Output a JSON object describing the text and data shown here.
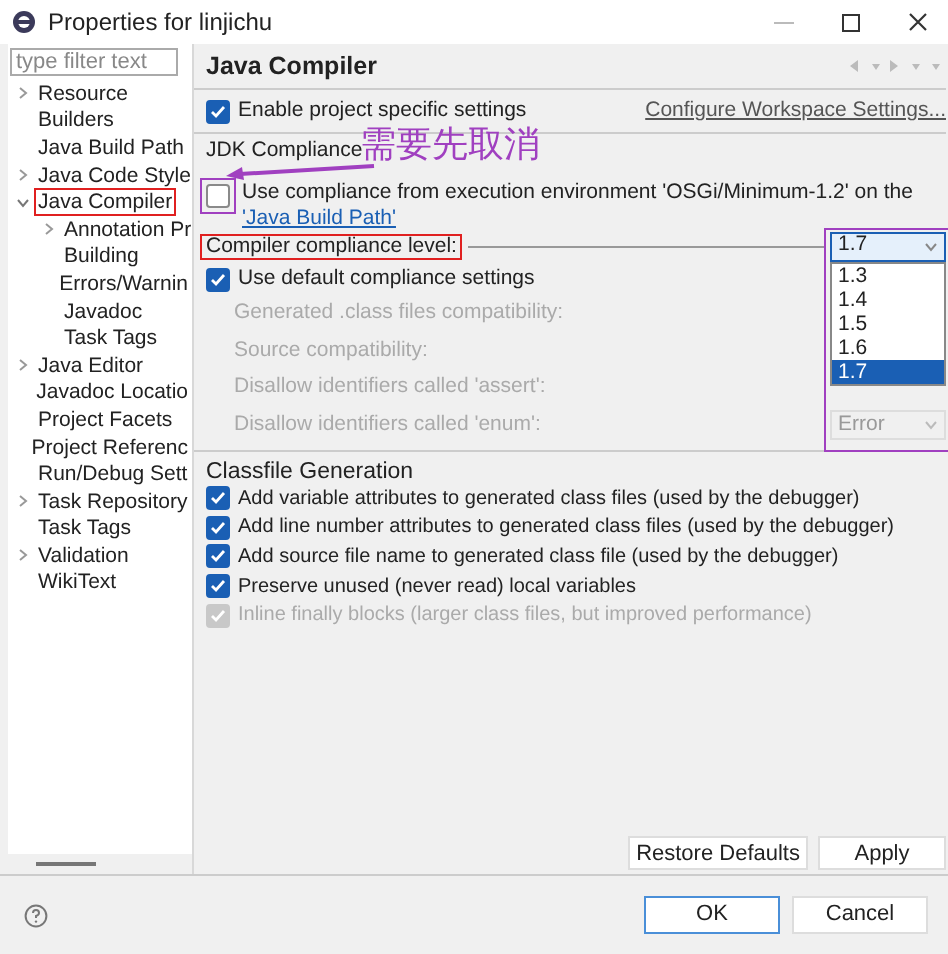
{
  "window": {
    "title": "Properties for linjichu"
  },
  "sidebar": {
    "filter": {
      "placeholder": "type filter text"
    },
    "items": [
      {
        "label": "Resource",
        "expanded": false
      },
      {
        "label": "Builders"
      },
      {
        "label": "Java Build Path"
      },
      {
        "label": "Java Code Style",
        "expanded": false
      },
      {
        "label": "Java Compiler",
        "expanded": true,
        "annotated": true,
        "children": [
          {
            "label": "Annotation Pr",
            "expanded": false
          },
          {
            "label": "Building"
          },
          {
            "label": "Errors/Warnin"
          },
          {
            "label": "Javadoc"
          },
          {
            "label": "Task Tags"
          }
        ]
      },
      {
        "label": "Java Editor",
        "expanded": false
      },
      {
        "label": "Javadoc Locatio"
      },
      {
        "label": "Project Facets"
      },
      {
        "label": "Project Referenc"
      },
      {
        "label": "Run/Debug Sett"
      },
      {
        "label": "Task Repository",
        "expanded": false
      },
      {
        "label": "Task Tags"
      },
      {
        "label": "Validation",
        "expanded": false
      },
      {
        "label": "WikiText"
      }
    ]
  },
  "page": {
    "title": "Java Compiler",
    "enable_specific": {
      "label": "Enable project specific settings",
      "checked": true
    },
    "configure_link": "Configure Workspace Settings...",
    "jdk_group": {
      "title": "JDK Compliance",
      "use_ee": {
        "label": "Use compliance from execution environment 'OSGi/Minimum-1.2' on the ",
        "link": "'Java Build Path'",
        "checked": false,
        "annotated": true
      },
      "compliance_label": {
        "text": "Compiler compliance level:",
        "annotated": true
      },
      "compliance_dropdown": {
        "value": "1.7",
        "annotated": true,
        "options": [
          {
            "label": "1.3",
            "selected": false
          },
          {
            "label": "1.4",
            "selected": false
          },
          {
            "label": "1.5",
            "selected": false
          },
          {
            "label": "1.6",
            "selected": false
          },
          {
            "label": "1.7",
            "selected": true
          }
        ]
      },
      "use_default": {
        "label": "Use default compliance settings",
        "checked": true
      },
      "settings": [
        {
          "label": "Generated .class files compatibility:"
        },
        {
          "label": "Source compatibility:"
        },
        {
          "label": "Disallow identifiers called 'assert':"
        },
        {
          "label": "Disallow identifiers called 'enum':",
          "value": "Error"
        }
      ]
    },
    "classfile_group": {
      "title": "Classfile Generation",
      "options": [
        {
          "label": "Add variable attributes to generated class files (used by the debugger)",
          "checked": true,
          "disabled": false
        },
        {
          "label": "Add line number attributes to generated class files (used by the debugger)",
          "checked": true,
          "disabled": false
        },
        {
          "label": "Add source file name to generated class file (used by the debugger)",
          "checked": true,
          "disabled": false
        },
        {
          "label": "Preserve unused (never read) local variables",
          "checked": true,
          "disabled": false
        },
        {
          "label": "Inline finally blocks (larger class files, but improved performance)",
          "checked": true,
          "disabled": true
        }
      ]
    },
    "buttons": [
      "Restore Defaults",
      "Apply"
    ]
  },
  "annotation": {
    "note": "需要先取消"
  },
  "footer": {
    "buttons": [
      {
        "label": "OK",
        "kind": "default"
      },
      {
        "label": "Cancel",
        "kind": "normal"
      }
    ]
  }
}
